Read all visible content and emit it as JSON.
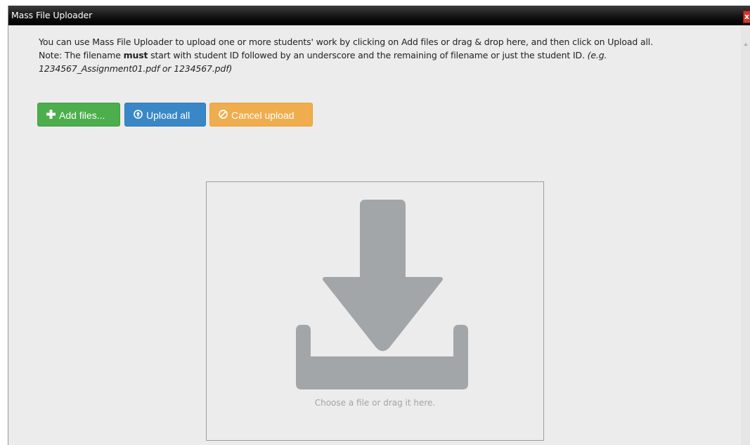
{
  "window": {
    "title": "Mass File Uploader",
    "close_glyph": "x"
  },
  "intro": {
    "line1": "You can use Mass File Uploader to upload one or more students' work by clicking on Add files or drag & drop here, and then click on Upload all.",
    "note_prefix": "Note: The filename ",
    "note_bold": "must",
    "note_rest": " start with student ID followed by an underscore and the remaining of filename or just the student ID. ",
    "note_example": "(e.g. 1234567_Assignment01.pdf or 1234567.pdf)"
  },
  "buttons": {
    "add_files": "Add files...",
    "upload_all": "Upload all",
    "cancel_upload": "Cancel upload"
  },
  "dropzone": {
    "hint": "Choose a file or drag it here.",
    "icon": "download-icon"
  },
  "colors": {
    "add": "#4cae4c",
    "upload": "#3a87c8",
    "cancel": "#f0ad4e",
    "drop_icon": "#a3a6a8"
  }
}
